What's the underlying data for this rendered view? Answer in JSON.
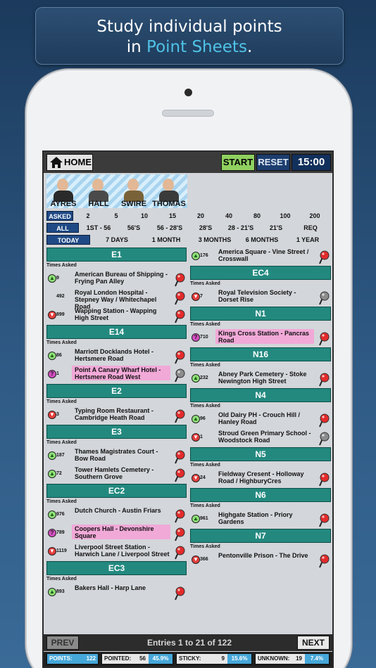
{
  "banner": {
    "line1": "Study individual points",
    "line2_pre": "in ",
    "line2_hl": "Point Sheets",
    "line2_post": "."
  },
  "toolbar": {
    "home": "HOME",
    "start": "START",
    "reset": "RESET",
    "timer": "15:00"
  },
  "avatars": [
    "AYRES",
    "HALL",
    "SWIRE",
    "THOMAS"
  ],
  "filters": {
    "asked": [
      "ASKED",
      "2",
      "5",
      "10",
      "15",
      "20",
      "40",
      "80",
      "100",
      "200"
    ],
    "range": [
      "ALL",
      "1ST - 56",
      "56'S",
      "56 - 28'S",
      "28'S",
      "28 - 21'S",
      "21'S",
      "REQ"
    ],
    "period": [
      "TODAY",
      "7 DAYS",
      "1 MONTH",
      "3 MONTHS",
      "6 MONTHS",
      "1 YEAR"
    ]
  },
  "left": [
    {
      "type": "hdr",
      "label": "E1"
    },
    {
      "type": "ta",
      "label": "Times Asked"
    },
    {
      "type": "ent",
      "icon": "g",
      "count": "9",
      "name": "American Bureau of Shipping - Frying Pan Alley",
      "pin": "red"
    },
    {
      "type": "ent",
      "icon": "",
      "count": "492",
      "name": "Royal London Hospital - Stepney Way / Whitechapel Road",
      "pin": "red"
    },
    {
      "type": "ent",
      "icon": "r",
      "count": "899",
      "name": "Wapping Station - Wapping High Street",
      "pin": "red"
    },
    {
      "type": "hdr",
      "label": "E14"
    },
    {
      "type": "ta",
      "label": "Times Asked"
    },
    {
      "type": "ent",
      "icon": "g",
      "count": "86",
      "name": "Marriott Docklands Hotel - Hertsmere Road",
      "pin": "red"
    },
    {
      "type": "ent",
      "icon": "p",
      "count": "1",
      "name": "Point A Canary Wharf Hotel - Hertsmere Road West",
      "pin": "grey",
      "pink": true
    },
    {
      "type": "hdr",
      "label": "E2"
    },
    {
      "type": "ta",
      "label": "Times Asked"
    },
    {
      "type": "ent",
      "icon": "r",
      "count": "3",
      "name": "Typing Room Restaurant - Cambridge Heath Road",
      "pin": "red"
    },
    {
      "type": "hdr",
      "label": "E3"
    },
    {
      "type": "ta",
      "label": "Times Asked"
    },
    {
      "type": "ent",
      "icon": "g",
      "count": "187",
      "name": "Thames Magistrates Court - Bow Road",
      "pin": "red"
    },
    {
      "type": "ent",
      "icon": "g",
      "count": "72",
      "name": "Tower Hamlets Cemetery - Southern Grove",
      "pin": "red"
    },
    {
      "type": "hdr",
      "label": "EC2"
    },
    {
      "type": "ta",
      "label": "Times Asked"
    },
    {
      "type": "ent",
      "icon": "g",
      "count": "976",
      "name": "Dutch Church - Austin Friars",
      "pin": "red"
    },
    {
      "type": "ent",
      "icon": "p",
      "count": "789",
      "name": "Coopers Hall - Devonshire Square",
      "pin": "red",
      "pink": true
    },
    {
      "type": "ent",
      "icon": "r",
      "count": "1119",
      "name": "Liverpool Street Station - Harwich Lane / Liverpool Street",
      "pin": "red"
    },
    {
      "type": "hdr",
      "label": "EC3"
    },
    {
      "type": "ta",
      "label": "Times Asked"
    },
    {
      "type": "ent",
      "icon": "g",
      "count": "893",
      "name": "Bakers Hall - Harp Lane",
      "pin": "red"
    }
  ],
  "right": [
    {
      "type": "ent",
      "icon": "g",
      "count": "176",
      "name": "America Square - Vine Street / Crosswall",
      "pin": "red"
    },
    {
      "type": "hdr",
      "label": "EC4"
    },
    {
      "type": "ta",
      "label": "Times Asked"
    },
    {
      "type": "ent",
      "icon": "r",
      "count": "7",
      "name": "Royal Television Society - Dorset Rise",
      "pin": "grey"
    },
    {
      "type": "hdr",
      "label": "N1"
    },
    {
      "type": "ta",
      "label": "Times Asked"
    },
    {
      "type": "ent",
      "icon": "p",
      "count": "710",
      "name": "Kings Cross Station - Pancras Road",
      "pin": "red",
      "pink": true
    },
    {
      "type": "hdr",
      "label": "N16"
    },
    {
      "type": "ta",
      "label": "Times Asked"
    },
    {
      "type": "ent",
      "icon": "g",
      "count": "232",
      "name": "Abney Park Cemetery - Stoke Newington High Street",
      "pin": "red"
    },
    {
      "type": "hdr",
      "label": "N4"
    },
    {
      "type": "ta",
      "label": "Times Asked"
    },
    {
      "type": "ent",
      "icon": "g",
      "count": "96",
      "name": "Old Dairy PH - Crouch Hill / Hanley Road",
      "pin": "red"
    },
    {
      "type": "ent",
      "icon": "r",
      "count": "1",
      "name": "Stroud Green Primary School - Woodstock Road",
      "pin": "grey"
    },
    {
      "type": "hdr",
      "label": "N5"
    },
    {
      "type": "ta",
      "label": "Times Asked"
    },
    {
      "type": "ent",
      "icon": "r",
      "count": "24",
      "name": "Fieldway Cresent - Holloway Road / HighburyCres",
      "pin": "red"
    },
    {
      "type": "hdr",
      "label": "N6"
    },
    {
      "type": "ta",
      "label": "Times Asked"
    },
    {
      "type": "ent",
      "icon": "g",
      "count": "961",
      "name": "Highgate Station - Priory Gardens",
      "pin": "red"
    },
    {
      "type": "hdr",
      "label": "N7"
    },
    {
      "type": "ta",
      "label": "Times Asked"
    },
    {
      "type": "ent",
      "icon": "r",
      "count": "366",
      "name": "Pentonville Prison - The Drive",
      "pin": "red"
    }
  ],
  "footer": {
    "prev": "PREV",
    "next": "NEXT",
    "entries": "Entries 1 to 21 of 122"
  },
  "stats": [
    {
      "label": "POINTS:",
      "value": "122",
      "pct": ""
    },
    {
      "label": "POINTED:",
      "value": "56",
      "pct": "45.9%"
    },
    {
      "label": "STICKY:",
      "value": "9",
      "pct": "15.6%"
    },
    {
      "label": "UNKNOWN:",
      "value": "19",
      "pct": "7.4%"
    }
  ],
  "colors": {
    "header": "#23897f",
    "selected": "#1f4a86",
    "pink": "#f1a9d8",
    "pin_red": "#e32b2b",
    "pin_grey": "#8c8c8c"
  }
}
